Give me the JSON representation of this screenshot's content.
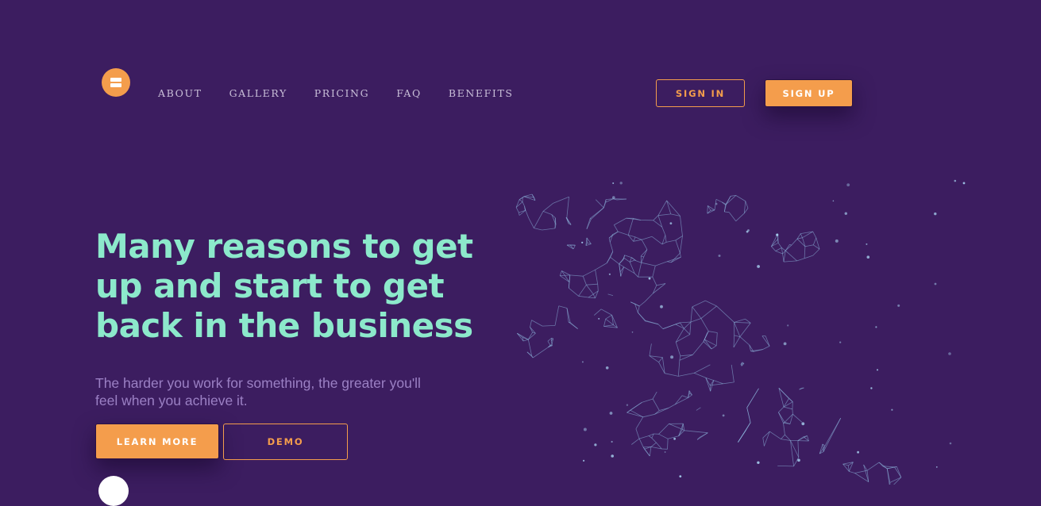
{
  "nav": {
    "items": [
      "ABOUT",
      "GALLERY",
      "PRICING",
      "FAQ",
      "BENEFITS"
    ]
  },
  "header": {
    "sign_in": "SIGN IN",
    "sign_up": "SIGN UP"
  },
  "hero": {
    "title": "Many reasons to get up and start to get back in the business",
    "subtitle": "The harder you work for something, the greater you'll feel when you achieve it.",
    "learn_more": "LEARN MORE",
    "demo": "DEMO"
  },
  "colors": {
    "background": "#3c1d60",
    "accent": "#f49d4c",
    "headline": "#8ce9cb",
    "subtext": "#9b80c4",
    "figure_lines": "#8fb9e0"
  },
  "icons": {
    "logo": "stacked-bars-logo",
    "hero_figure": "low-poly-wireframe-runner"
  }
}
